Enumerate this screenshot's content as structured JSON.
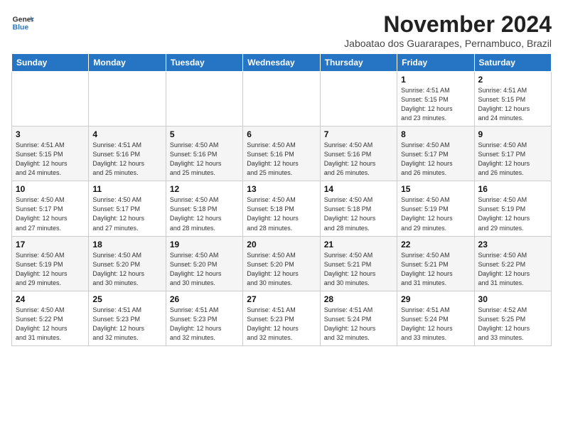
{
  "header": {
    "logo_line1": "General",
    "logo_line2": "Blue",
    "month_title": "November 2024",
    "location": "Jaboatao dos Guararapes, Pernambuco, Brazil"
  },
  "weekdays": [
    "Sunday",
    "Monday",
    "Tuesday",
    "Wednesday",
    "Thursday",
    "Friday",
    "Saturday"
  ],
  "weeks": [
    [
      {
        "day": "",
        "info": ""
      },
      {
        "day": "",
        "info": ""
      },
      {
        "day": "",
        "info": ""
      },
      {
        "day": "",
        "info": ""
      },
      {
        "day": "",
        "info": ""
      },
      {
        "day": "1",
        "info": "Sunrise: 4:51 AM\nSunset: 5:15 PM\nDaylight: 12 hours\nand 23 minutes."
      },
      {
        "day": "2",
        "info": "Sunrise: 4:51 AM\nSunset: 5:15 PM\nDaylight: 12 hours\nand 24 minutes."
      }
    ],
    [
      {
        "day": "3",
        "info": "Sunrise: 4:51 AM\nSunset: 5:15 PM\nDaylight: 12 hours\nand 24 minutes."
      },
      {
        "day": "4",
        "info": "Sunrise: 4:51 AM\nSunset: 5:16 PM\nDaylight: 12 hours\nand 25 minutes."
      },
      {
        "day": "5",
        "info": "Sunrise: 4:50 AM\nSunset: 5:16 PM\nDaylight: 12 hours\nand 25 minutes."
      },
      {
        "day": "6",
        "info": "Sunrise: 4:50 AM\nSunset: 5:16 PM\nDaylight: 12 hours\nand 25 minutes."
      },
      {
        "day": "7",
        "info": "Sunrise: 4:50 AM\nSunset: 5:16 PM\nDaylight: 12 hours\nand 26 minutes."
      },
      {
        "day": "8",
        "info": "Sunrise: 4:50 AM\nSunset: 5:17 PM\nDaylight: 12 hours\nand 26 minutes."
      },
      {
        "day": "9",
        "info": "Sunrise: 4:50 AM\nSunset: 5:17 PM\nDaylight: 12 hours\nand 26 minutes."
      }
    ],
    [
      {
        "day": "10",
        "info": "Sunrise: 4:50 AM\nSunset: 5:17 PM\nDaylight: 12 hours\nand 27 minutes."
      },
      {
        "day": "11",
        "info": "Sunrise: 4:50 AM\nSunset: 5:17 PM\nDaylight: 12 hours\nand 27 minutes."
      },
      {
        "day": "12",
        "info": "Sunrise: 4:50 AM\nSunset: 5:18 PM\nDaylight: 12 hours\nand 28 minutes."
      },
      {
        "day": "13",
        "info": "Sunrise: 4:50 AM\nSunset: 5:18 PM\nDaylight: 12 hours\nand 28 minutes."
      },
      {
        "day": "14",
        "info": "Sunrise: 4:50 AM\nSunset: 5:18 PM\nDaylight: 12 hours\nand 28 minutes."
      },
      {
        "day": "15",
        "info": "Sunrise: 4:50 AM\nSunset: 5:19 PM\nDaylight: 12 hours\nand 29 minutes."
      },
      {
        "day": "16",
        "info": "Sunrise: 4:50 AM\nSunset: 5:19 PM\nDaylight: 12 hours\nand 29 minutes."
      }
    ],
    [
      {
        "day": "17",
        "info": "Sunrise: 4:50 AM\nSunset: 5:19 PM\nDaylight: 12 hours\nand 29 minutes."
      },
      {
        "day": "18",
        "info": "Sunrise: 4:50 AM\nSunset: 5:20 PM\nDaylight: 12 hours\nand 30 minutes."
      },
      {
        "day": "19",
        "info": "Sunrise: 4:50 AM\nSunset: 5:20 PM\nDaylight: 12 hours\nand 30 minutes."
      },
      {
        "day": "20",
        "info": "Sunrise: 4:50 AM\nSunset: 5:20 PM\nDaylight: 12 hours\nand 30 minutes."
      },
      {
        "day": "21",
        "info": "Sunrise: 4:50 AM\nSunset: 5:21 PM\nDaylight: 12 hours\nand 30 minutes."
      },
      {
        "day": "22",
        "info": "Sunrise: 4:50 AM\nSunset: 5:21 PM\nDaylight: 12 hours\nand 31 minutes."
      },
      {
        "day": "23",
        "info": "Sunrise: 4:50 AM\nSunset: 5:22 PM\nDaylight: 12 hours\nand 31 minutes."
      }
    ],
    [
      {
        "day": "24",
        "info": "Sunrise: 4:50 AM\nSunset: 5:22 PM\nDaylight: 12 hours\nand 31 minutes."
      },
      {
        "day": "25",
        "info": "Sunrise: 4:51 AM\nSunset: 5:23 PM\nDaylight: 12 hours\nand 32 minutes."
      },
      {
        "day": "26",
        "info": "Sunrise: 4:51 AM\nSunset: 5:23 PM\nDaylight: 12 hours\nand 32 minutes."
      },
      {
        "day": "27",
        "info": "Sunrise: 4:51 AM\nSunset: 5:23 PM\nDaylight: 12 hours\nand 32 minutes."
      },
      {
        "day": "28",
        "info": "Sunrise: 4:51 AM\nSunset: 5:24 PM\nDaylight: 12 hours\nand 32 minutes."
      },
      {
        "day": "29",
        "info": "Sunrise: 4:51 AM\nSunset: 5:24 PM\nDaylight: 12 hours\nand 33 minutes."
      },
      {
        "day": "30",
        "info": "Sunrise: 4:52 AM\nSunset: 5:25 PM\nDaylight: 12 hours\nand 33 minutes."
      }
    ]
  ]
}
